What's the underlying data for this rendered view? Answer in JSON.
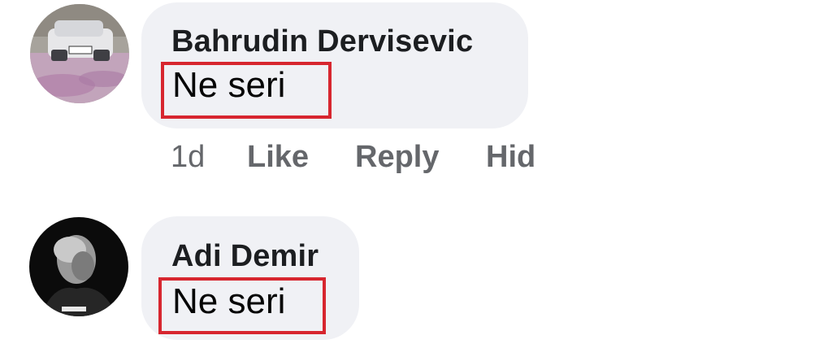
{
  "comments": [
    {
      "author": "Bahrudin Dervisevic",
      "text": "Ne seri",
      "timestamp": "1d",
      "actions": [
        "Like",
        "Reply",
        "Hid"
      ]
    },
    {
      "author": "Adi Demir",
      "text": "Ne seri"
    }
  ],
  "colors": {
    "bubble": "#f0f1f5",
    "highlight": "#d7262f",
    "meta_text": "#65676b"
  }
}
